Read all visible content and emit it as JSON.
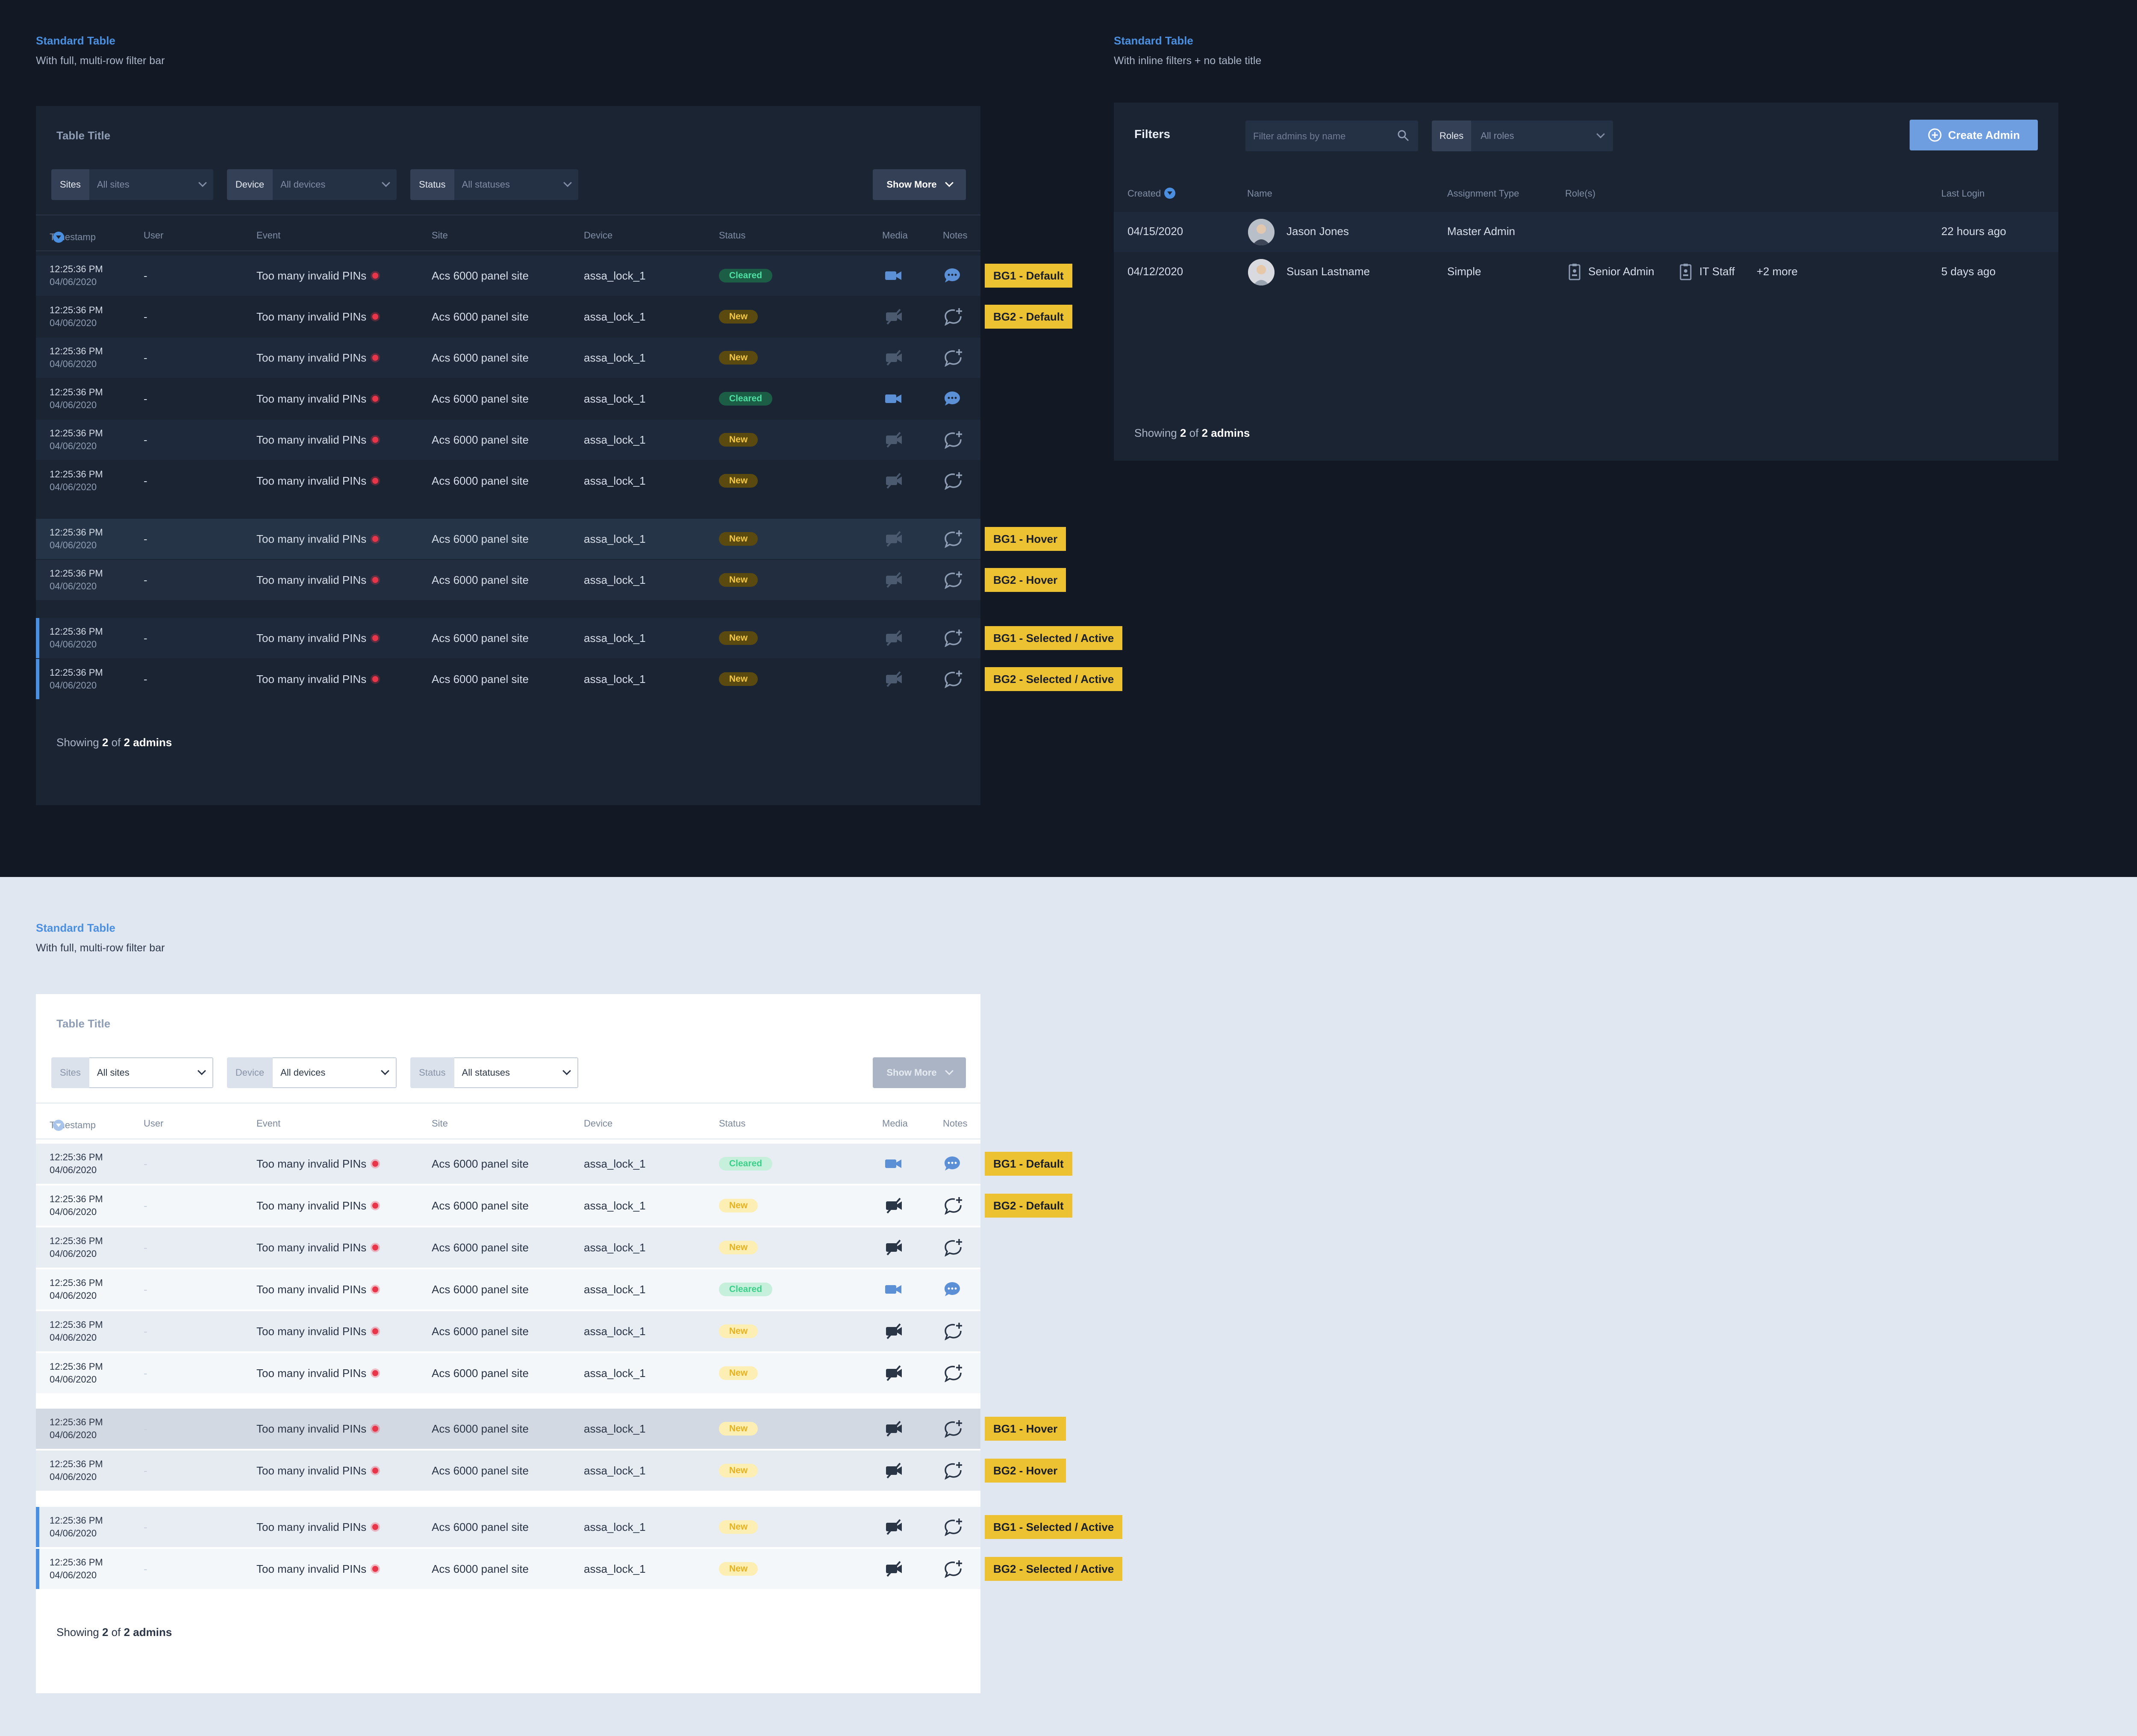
{
  "dark_section_1": {
    "title": "Standard Table",
    "subtitle": "With full, multi-row filter bar"
  },
  "dark_section_2": {
    "title": "Standard Table",
    "subtitle": "With inline filters + no table title"
  },
  "light_section": {
    "title": "Standard Table",
    "subtitle": "With full, multi-row filter bar"
  },
  "event_table": {
    "title": "Table Title",
    "filters": [
      {
        "label": "Sites",
        "value": "All sites"
      },
      {
        "label": "Device",
        "value": "All devices"
      },
      {
        "label": "Status",
        "value": "All statuses"
      }
    ],
    "show_more": "Show More",
    "columns": [
      "Timestamp",
      "User",
      "Event",
      "Site",
      "Device",
      "Status",
      "Media",
      "Notes"
    ],
    "row": {
      "time": "12:25:36 PM",
      "date": "04/06/2020",
      "user": "-",
      "event": "Too many invalid PINs",
      "site": "Acs 6000 panel site",
      "device": "assa_lock_1"
    },
    "status_cleared": "Cleared",
    "status_new": "New",
    "state_labels": {
      "bg1_default": "BG1 - Default",
      "bg2_default": "BG2 - Default",
      "bg1_hover": "BG1 - Hover",
      "bg2_hover": "BG2 - Hover",
      "bg1_selected": "BG1 - Selected / Active",
      "bg2_selected": "BG2 - Selected / Active"
    },
    "footer": {
      "prefix": "Showing",
      "shown": "2",
      "of": "of",
      "total": "2 admins"
    }
  },
  "admin_table": {
    "filters_label": "Filters",
    "search_placeholder": "Filter admins by name",
    "roles_label": "Roles",
    "roles_value": "All roles",
    "create_button": "Create Admin",
    "columns": [
      "Created",
      "Name",
      "Assignment Type",
      "Role(s)",
      "Last Login"
    ],
    "rows": [
      {
        "created": "04/15/2020",
        "name": "Jason Jones",
        "assignment": "Master Admin",
        "roles": [],
        "more": "",
        "last_login": "22 hours ago"
      },
      {
        "created": "04/12/2020",
        "name": "Susan Lastname",
        "assignment": "Simple",
        "roles": [
          "Senior Admin",
          "IT Staff"
        ],
        "more": "+2 more",
        "last_login": "5 days ago"
      }
    ],
    "footer": {
      "prefix": "Showing",
      "shown": "2",
      "of": "of",
      "total": "2 admins"
    }
  },
  "colors": {
    "dark_bg": "#121924",
    "light_bg": "#e1e7f0",
    "accent": "#4a8fe0",
    "label_yellow": "#ecc233",
    "alert_red": "#e8354a"
  }
}
